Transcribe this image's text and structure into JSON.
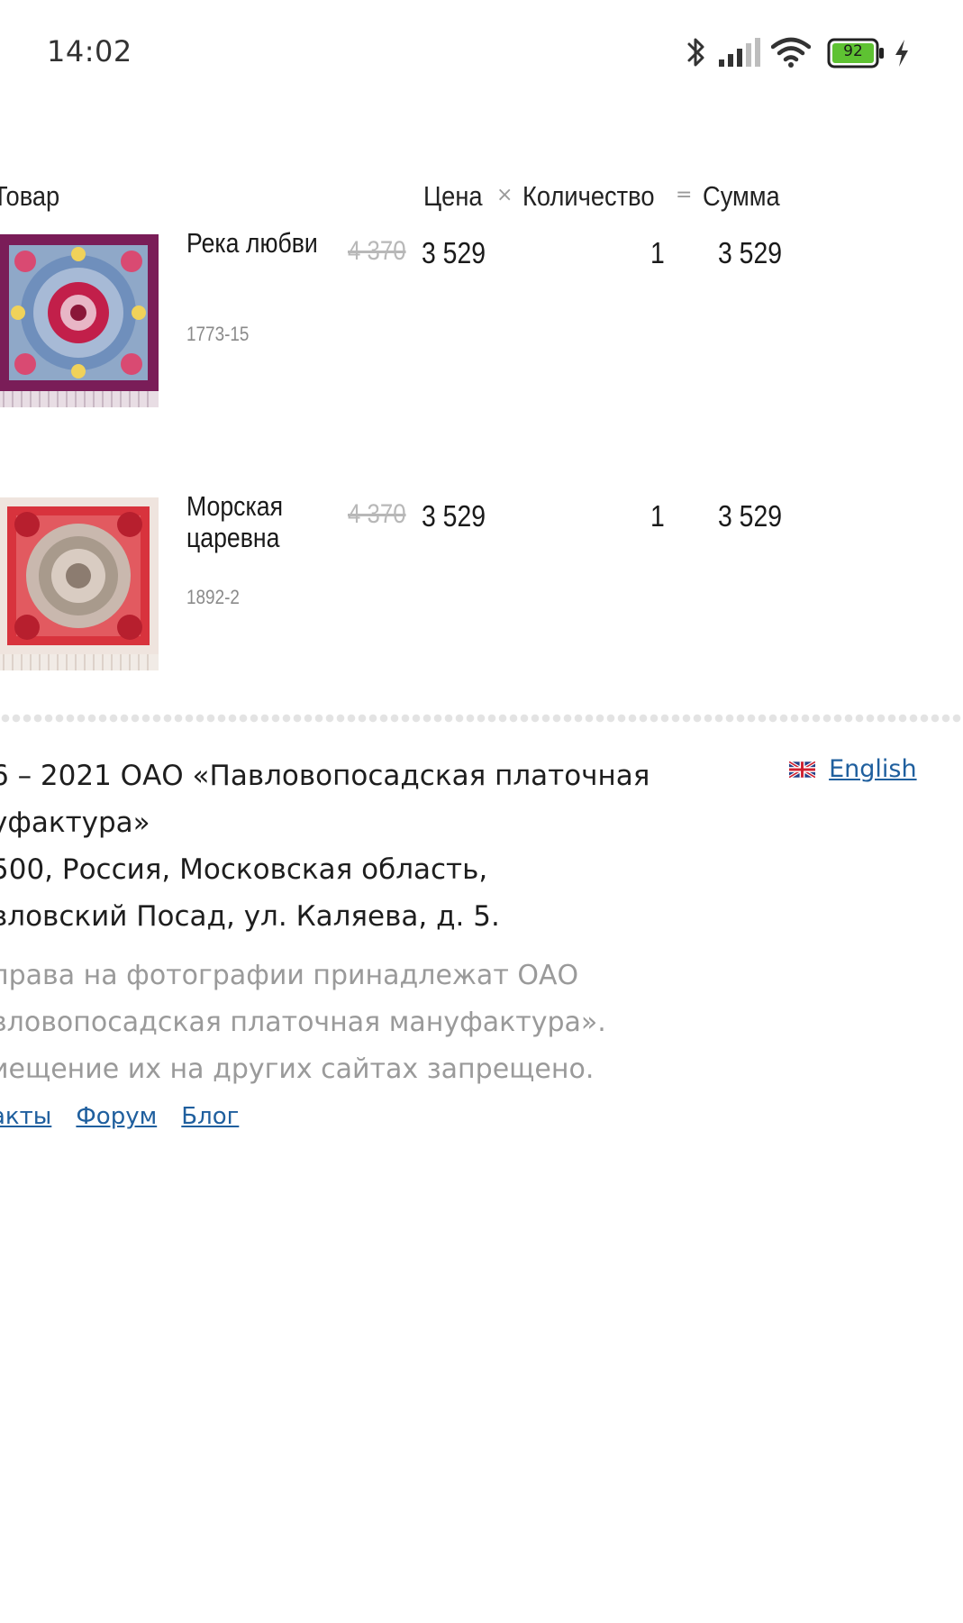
{
  "status_bar": {
    "time": "14:02",
    "battery_level": "92",
    "battery_color": "#5ec232",
    "icons": [
      "bluetooth-icon",
      "cellular-signal-icon",
      "wifi-icon",
      "battery-icon",
      "charging-bolt-icon"
    ]
  },
  "cart": {
    "headers": {
      "product": "Товар",
      "price": "Цена",
      "times_sign": "×",
      "quantity": "Количество",
      "equals_sign": "=",
      "sum": "Сумма"
    },
    "items": [
      {
        "name": "Река любви",
        "sku": "1773-15",
        "old_price": "4 370",
        "price": "3 529",
        "quantity": "1",
        "sum": "3 529",
        "thumb_colors": {
          "background": "#7a1d58",
          "inner": "#8fa8c8",
          "accent": "#c21f4a",
          "fringe": "#e8dde4"
        }
      },
      {
        "name": "Морская царевна",
        "sku": "1892-2",
        "old_price": "4 370",
        "price": "3 529",
        "quantity": "1",
        "sum": "3 529",
        "thumb_colors": {
          "background": "#efe4de",
          "inner": "#d8333d",
          "accent": "#a89a8c",
          "fringe": "#f1ebe6"
        }
      }
    ]
  },
  "footer": {
    "copyright_lines": [
      "6 – 2021 ОАО «Павловопосадская платочная",
      "уфактура»",
      "500, Россия, Московская область,",
      "вловский Посад, ул. Каляева, д. 5."
    ],
    "notice_lines": [
      "права на фотографии принадлежат ОАО",
      "вловопосадская платочная мануфактура».",
      "иещение их на других сайтах запрещено."
    ],
    "links": [
      "акты",
      "Форум",
      "Блог"
    ],
    "language_link": "English",
    "language_flag_icon": "uk-flag-icon",
    "link_color": "#1f5f9e"
  }
}
